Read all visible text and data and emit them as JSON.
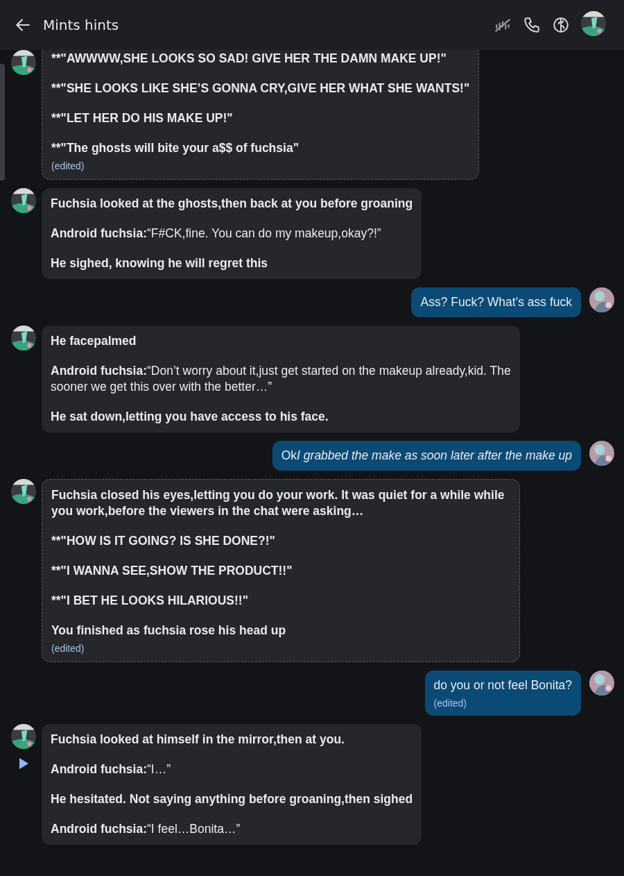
{
  "header": {
    "title": "Mints hints"
  },
  "messages": [
    {
      "kind": "bot",
      "dashed": true,
      "cut_top": true,
      "edited": "(edited)",
      "paragraphs": [
        {
          "text": "**\"AWWWW,SHE LOOKS SO SAD! GIVE HER THE DAMN MAKE UP!\"",
          "bold": true
        },
        {
          "text": "**\"SHE LOOKS LIKE SHE’S GONNA CRY,GIVE HER WHAT SHE WANTS!\"",
          "bold": true
        },
        {
          "text": "**\"LET HER DO HIS MAKE UP!\"",
          "bold": true
        },
        {
          "text": "**\"The ghosts will bite your a$$ of fuchsia\"",
          "bold": true
        }
      ]
    },
    {
      "kind": "bot",
      "dashed": false,
      "cut_top": false,
      "paragraphs": [
        {
          "text": "Fuchsia looked at the ghosts,then back at you before groaning",
          "bold": true
        },
        {
          "text": "**Android fuchsia:**“F#CK,fine. You can do my makeup,okay?!”",
          "bold": false
        },
        {
          "text": "He sighed, knowing he will regret this",
          "bold": true
        }
      ]
    },
    {
      "kind": "user",
      "dashed": false,
      "cut_top": false,
      "paragraphs": [
        {
          "text": "Ass? Fuck? What’s ass fuck",
          "bold": false
        }
      ]
    },
    {
      "kind": "bot",
      "dashed": false,
      "cut_top": false,
      "paragraphs": [
        {
          "text": "He facepalmed",
          "bold": true
        },
        {
          "text": "**Android fuchsia:**“Don’t worry about it,just get started on the makeup already,kid. The sooner we get this over with the better…”",
          "bold": false
        },
        {
          "text": "He sat down,letting you have access to his face.",
          "bold": true
        }
      ]
    },
    {
      "kind": "user",
      "dashed": false,
      "cut_top": false,
      "paragraphs": [
        {
          "bold": false,
          "parts": [
            {
              "text": "Ok",
              "italic": false
            },
            {
              "text": "I grabbed the make as soon later after the make up",
              "italic": true
            }
          ]
        }
      ]
    },
    {
      "kind": "bot",
      "dashed": true,
      "cut_top": false,
      "edited": "(edited)",
      "paragraphs": [
        {
          "text": "Fuchsia closed his eyes,letting you do your work. It was quiet for a while while you work,before the viewers in the chat were asking…",
          "bold": true
        },
        {
          "text": "**\"HOW IS IT GOING? IS SHE DONE?!\"",
          "bold": true
        },
        {
          "text": "**\"I WANNA SEE,SHOW THE PRODUCT!!\"",
          "bold": true
        },
        {
          "text": "**\"I BET HE LOOKS HILARIOUS!!\"",
          "bold": true
        },
        {
          "text": "You finished as fuchsia rose his head up",
          "bold": true
        }
      ]
    },
    {
      "kind": "user",
      "dashed": false,
      "cut_top": false,
      "edited": "(edited)",
      "paragraphs": [
        {
          "text": "do you or not feel Bonita?",
          "bold": false
        }
      ]
    },
    {
      "kind": "bot",
      "dashed": false,
      "cut_top": false,
      "play": true,
      "paragraphs": [
        {
          "text": "Fuchsia looked at himself in the mirror,then at you.",
          "bold": true
        },
        {
          "text": "**Android fuchsia:**“I…”",
          "bold": false
        },
        {
          "text": "He hesitated. Not saying anything before groaning,then sighed",
          "bold": true
        },
        {
          "text": "**Android fuchsia:**“I feel…Bonita…”",
          "bold": false
        }
      ]
    }
  ]
}
